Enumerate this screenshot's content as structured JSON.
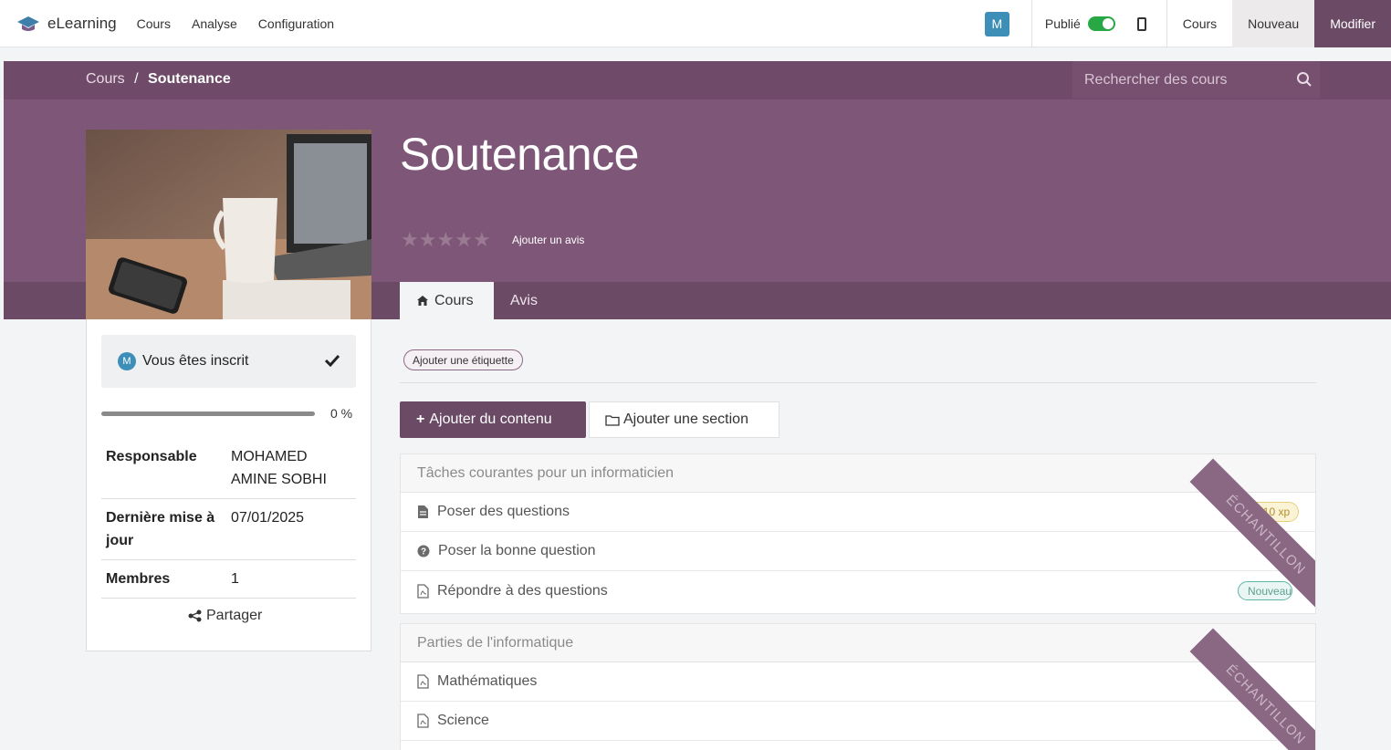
{
  "topbar": {
    "app_name": "eLearning",
    "menu": [
      "Cours",
      "Analyse",
      "Configuration"
    ],
    "user_initial": "M",
    "published_label": "Publié",
    "published": true,
    "buttons": [
      "Cours",
      "Nouveau",
      "Modifier"
    ]
  },
  "breadcrumb": {
    "parent": "Cours",
    "separator": "/",
    "current": "Soutenance"
  },
  "search": {
    "placeholder": "Rechercher des cours"
  },
  "course": {
    "title": "Soutenance",
    "rating_stars": 0,
    "add_review": "Ajouter un avis",
    "tabs": {
      "active": "Cours",
      "other": "Avis"
    }
  },
  "sidebar": {
    "enrolled_initial": "M",
    "enrolled_text": "Vous êtes inscrit",
    "progress_percent": 0,
    "progress_label": "0 %",
    "info": [
      {
        "key": "Responsable",
        "value": "MOHAMED AMINE SOBHI"
      },
      {
        "key": "Dernière mise à jour",
        "value": "07/01/2025"
      },
      {
        "key": "Membres",
        "value": "1"
      }
    ],
    "share": "Partager"
  },
  "main": {
    "add_tag": "Ajouter une étiquette",
    "add_content": "Ajouter du contenu",
    "add_section": "Ajouter une section",
    "sections": [
      {
        "title": "Tâches courantes pour un informaticien",
        "ribbon": "ÉCHANTILLON",
        "lessons": [
          {
            "label": "Poser des questions",
            "icon": "document-icon",
            "badge": "10 xp"
          },
          {
            "label": "Poser la bonne question",
            "icon": "question-circle-icon"
          },
          {
            "label": "Répondre à des questions",
            "icon": "pdf-icon",
            "badge": "Nouveau"
          }
        ]
      },
      {
        "title": "Parties de l'informatique",
        "ribbon": "ÉCHANTILLON",
        "lessons": [
          {
            "label": "Mathématiques",
            "icon": "pdf-icon"
          },
          {
            "label": "Science",
            "icon": "pdf-icon"
          }
        ]
      }
    ]
  },
  "colors": {
    "primary": "#6b4a66",
    "hero": "#7e5677",
    "published_toggle": "#28a745",
    "avatar": "#3d8fb8"
  }
}
